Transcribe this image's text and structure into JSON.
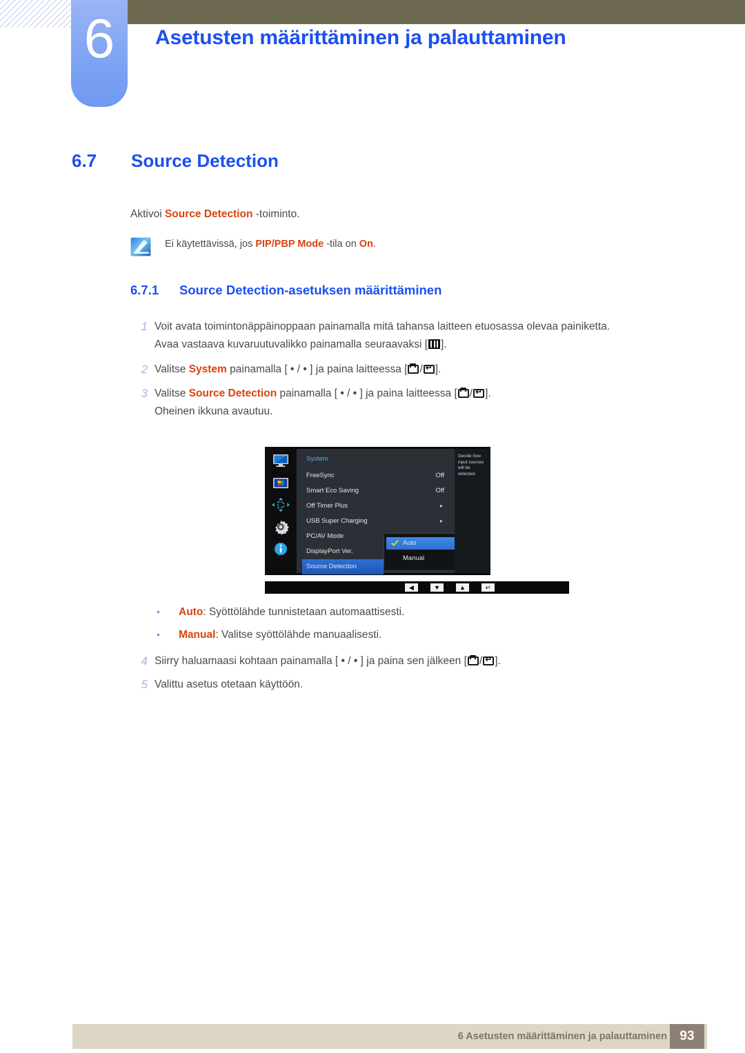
{
  "header": {
    "chapter_number": "6",
    "chapter_title": "Asetusten määrittäminen ja palauttaminen"
  },
  "section": {
    "number": "6.7",
    "title": "Source Detection"
  },
  "intro": {
    "prefix": "Aktivoi ",
    "highlight": "Source Detection",
    "suffix": " -toiminto."
  },
  "note": {
    "icon": "note-pencil-icon",
    "part1": "Ei käytettävissä, jos ",
    "hl1": "PIP/PBP Mode",
    "part2": " -tila on ",
    "hl2": "On",
    "part3": "."
  },
  "subsection": {
    "number": "6.7.1",
    "title": "Source Detection-asetuksen määrittäminen"
  },
  "steps": [
    {
      "n": "1",
      "line1": "Voit avata toimintonäppäinoppaan painamalla mitä tahansa laitteen etuosassa olevaa painiketta.",
      "line2_a": "Avaa vastaava kuvaruutuvalikko painamalla seuraavaksi [",
      "line2_b": "]."
    },
    {
      "n": "2",
      "a": "Valitse ",
      "hl": "System",
      "b": " painamalla [ ",
      "c": " / ",
      "d": " ] ja paina laitteessa [",
      "e": "/",
      "f": "]."
    },
    {
      "n": "3",
      "a": "Valitse ",
      "hl": "Source Detection",
      "b": " painamalla [ ",
      "c": " / ",
      "d": " ] ja paina laitteessa [",
      "e": "/",
      "f": "].",
      "line2": "Oheinen ikkuna avautuu."
    },
    {
      "n": "4",
      "a": "Siirry haluamaasi kohtaan painamalla [ ",
      "c": " / ",
      "d": " ] ja paina sen jälkeen [",
      "e": "/",
      "f": "]."
    },
    {
      "n": "5",
      "line1": "Valittu asetus otetaan käyttöön."
    }
  ],
  "osd": {
    "title": "System",
    "sidebar_icons": [
      "monitor-icon",
      "picture-icon",
      "pip-arrows-icon",
      "gear-icon",
      "info-icon"
    ],
    "rows": [
      {
        "label": "FreeSync",
        "value": "Off",
        "type": "value"
      },
      {
        "label": "Smart Eco Saving",
        "value": "Off",
        "type": "value"
      },
      {
        "label": "Off Timer Plus",
        "value": "▸",
        "type": "arrow"
      },
      {
        "label": "USB Super Charging",
        "value": "▸",
        "type": "arrow"
      },
      {
        "label": "PC/AV Mode",
        "value": "",
        "type": "none"
      },
      {
        "label": "DisplayPort Ver.",
        "value": "",
        "type": "none"
      },
      {
        "label": "Source Detection",
        "value": "",
        "type": "selected"
      }
    ],
    "dropdown": [
      {
        "label": "Auto",
        "checked": true
      },
      {
        "label": "Manual",
        "checked": false
      }
    ],
    "description": "Decide how input sources will be detected.",
    "nav_buttons": [
      "◀",
      "▼",
      "▲",
      "↵"
    ]
  },
  "bullets": [
    {
      "hl": "Auto",
      "text": ": Syöttölähde tunnistetaan automaattisesti."
    },
    {
      "hl": "Manual",
      "text": ": Valitse syöttölähde manuaalisesti."
    }
  ],
  "footer": {
    "text": "6 Asetusten määrittäminen ja palauttaminen",
    "page": "93"
  },
  "colors": {
    "accent_blue": "#1b4ff0",
    "highlight_orange": "#d8430f",
    "tab_blue": "#7ea4f2",
    "olive": "#6e6a52",
    "footer_beige": "#dcd7c4",
    "footer_page_brown": "#8d8076"
  }
}
